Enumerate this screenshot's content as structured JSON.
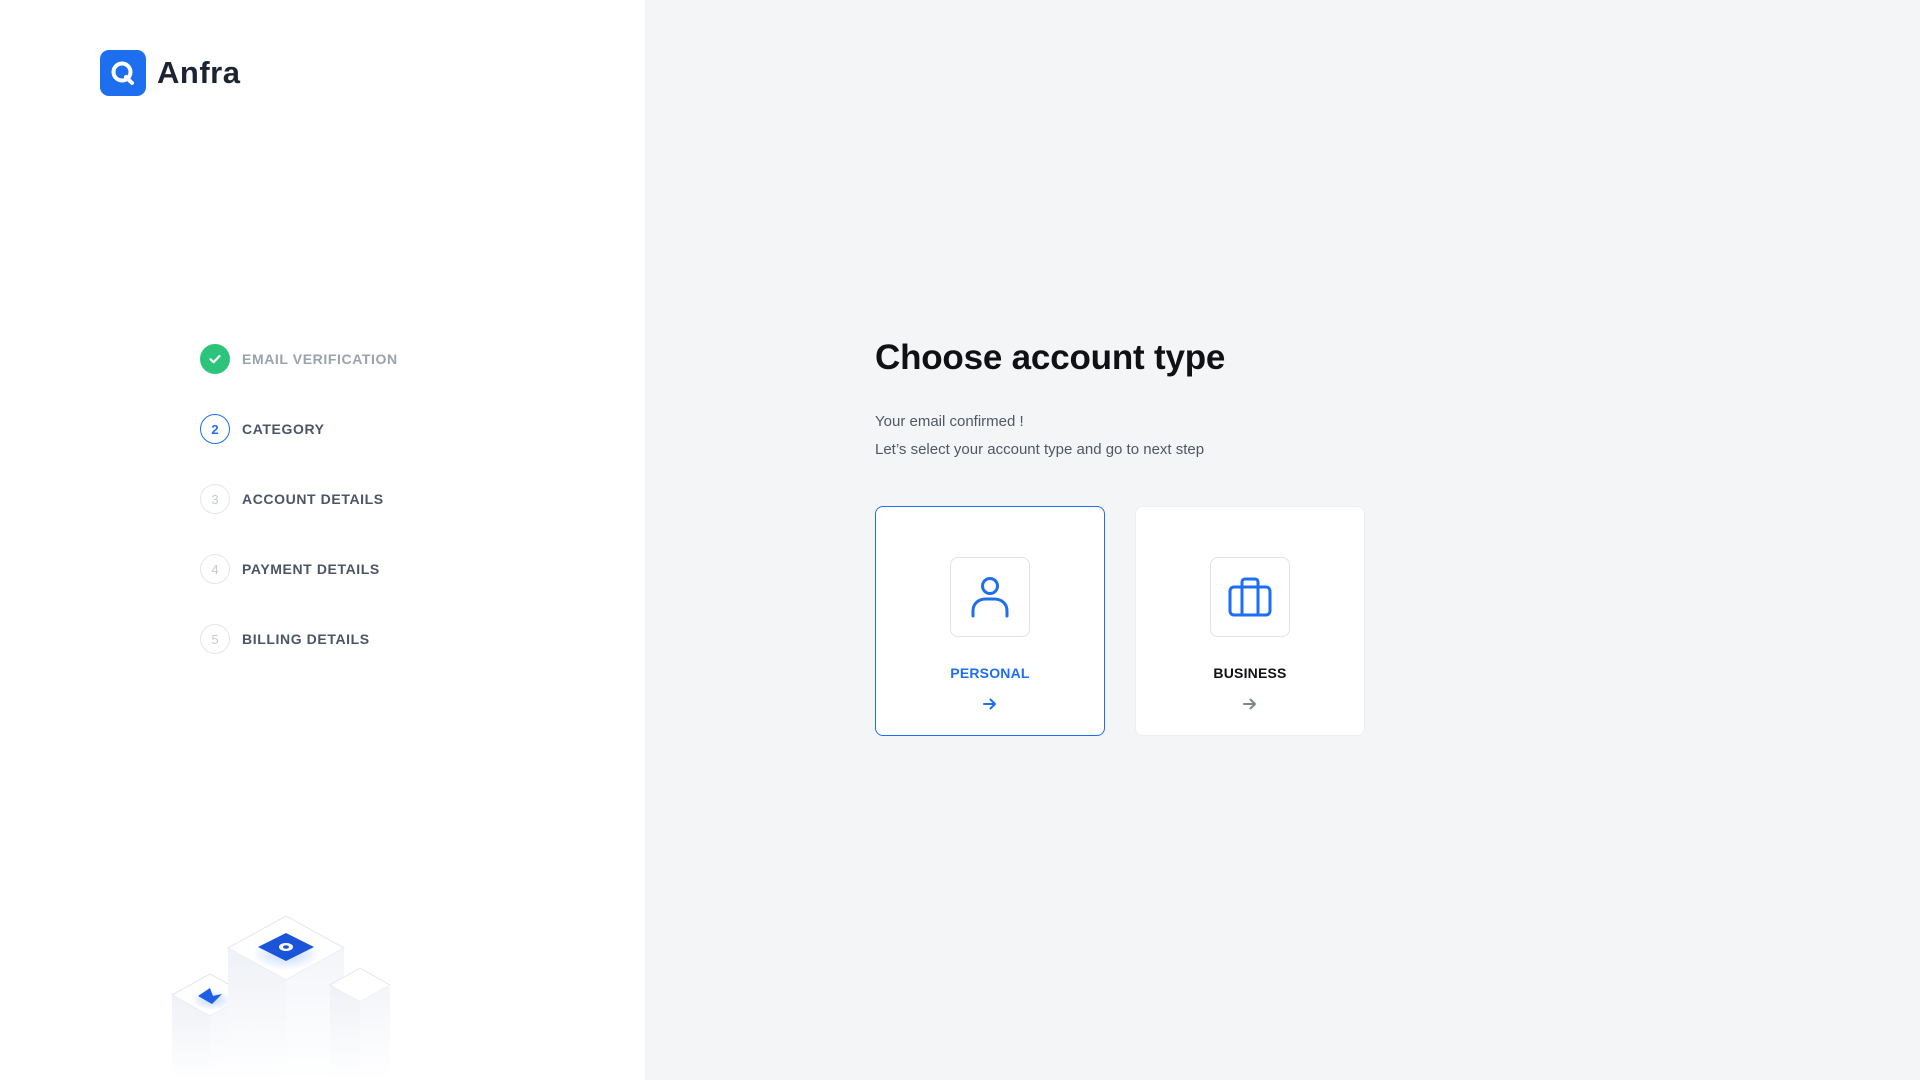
{
  "brand": {
    "name": "Anfra",
    "color": "#1e6ff0"
  },
  "steps": [
    {
      "number": "1",
      "label": "EMAIL VERIFICATION",
      "status": "done"
    },
    {
      "number": "2",
      "label": "CATEGORY",
      "status": "active"
    },
    {
      "number": "3",
      "label": "ACCOUNT DETAILS",
      "status": "pending"
    },
    {
      "number": "4",
      "label": "PAYMENT DETAILS",
      "status": "pending"
    },
    {
      "number": "5",
      "label": "BILLING DETAILS",
      "status": "pending"
    }
  ],
  "main": {
    "title": "Choose account type",
    "subtitle_line1": "Your email confirmed !",
    "subtitle_line2": "Let’s select your account type and go to next step"
  },
  "account_types": [
    {
      "label": "PERSONAL",
      "icon": "user-icon",
      "selected": true
    },
    {
      "label": "BUSINESS",
      "icon": "briefcase-icon",
      "selected": false
    }
  ],
  "colors": {
    "accent": "#1e6ff0",
    "success": "#2bc47a",
    "panel_bg": "#ffffff",
    "page_bg": "#f4f5f7"
  }
}
